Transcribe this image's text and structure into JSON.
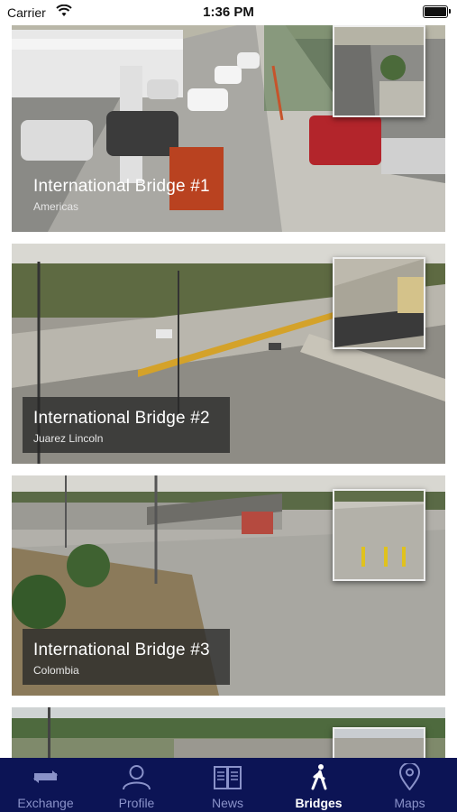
{
  "status_bar": {
    "carrier": "Carrier",
    "time": "1:36 PM"
  },
  "bridges": [
    {
      "title": "International Bridge #1",
      "subtitle": "Americas"
    },
    {
      "title": "International Bridge #2",
      "subtitle": "Juarez Lincoln"
    },
    {
      "title": "International Bridge #3",
      "subtitle": "Colombia"
    },
    {
      "title": "",
      "subtitle": ""
    }
  ],
  "tab_bar": {
    "items": [
      {
        "label": "Exchange",
        "icon": "exchange-icon"
      },
      {
        "label": "Profile",
        "icon": "profile-icon"
      },
      {
        "label": "News",
        "icon": "news-icon"
      },
      {
        "label": "Bridges",
        "icon": "walking-person-icon"
      },
      {
        "label": "Maps",
        "icon": "map-pin-icon"
      }
    ],
    "active": "Bridges",
    "colors": {
      "background": "#0c1455",
      "inactive": "#8a92c9",
      "active": "#ffffff"
    }
  }
}
